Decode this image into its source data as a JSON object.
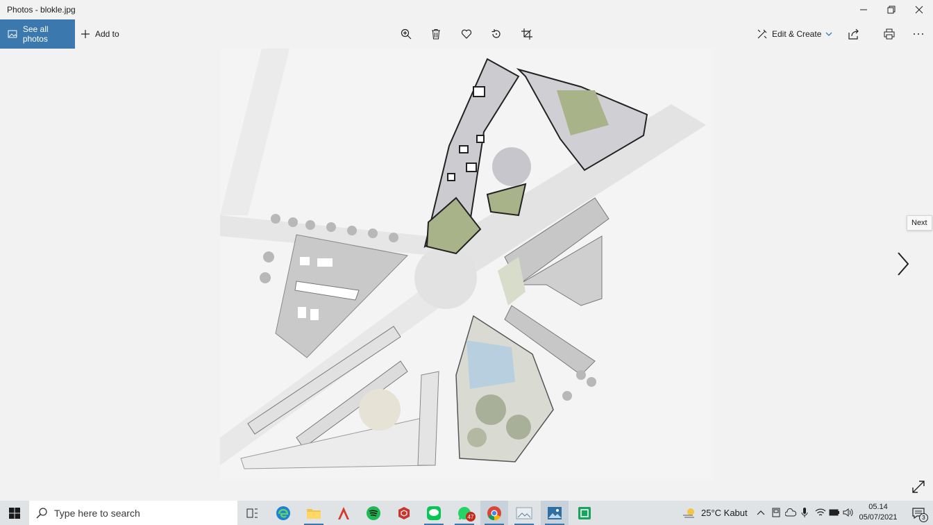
{
  "window": {
    "title": "Photos - blokle.jpg",
    "controls": [
      "minimize",
      "restore",
      "close"
    ]
  },
  "toolbar": {
    "see_all_photos": "See all photos",
    "add_to": "Add to",
    "edit_create": "Edit & Create",
    "icons": [
      "zoom-in-icon",
      "delete-icon",
      "heart-icon",
      "rotate-icon",
      "crop-icon",
      "share-icon",
      "print-icon",
      "more-icon"
    ]
  },
  "viewer": {
    "next_tooltip": "Next"
  },
  "taskbar": {
    "search_placeholder": "Type here to search",
    "apps": [
      "task-view",
      "edge",
      "file-explorer",
      "acrobat",
      "spotify",
      "sketchup",
      "line",
      "whatsapp",
      "chrome",
      "photos-viewer",
      "photos",
      "sheets"
    ],
    "whatsapp_badge": "47",
    "weather": "25°C  Kabut",
    "time": "05.14",
    "date": "05/07/2021",
    "notification_count": "3"
  },
  "colors": {
    "accent": "#3a78ad",
    "chrome_bg": "#f2f2f2",
    "taskbar_bg": "#dfe3e6",
    "plan_green": "#a9b38a",
    "plan_gray": "#cfcfcf"
  }
}
